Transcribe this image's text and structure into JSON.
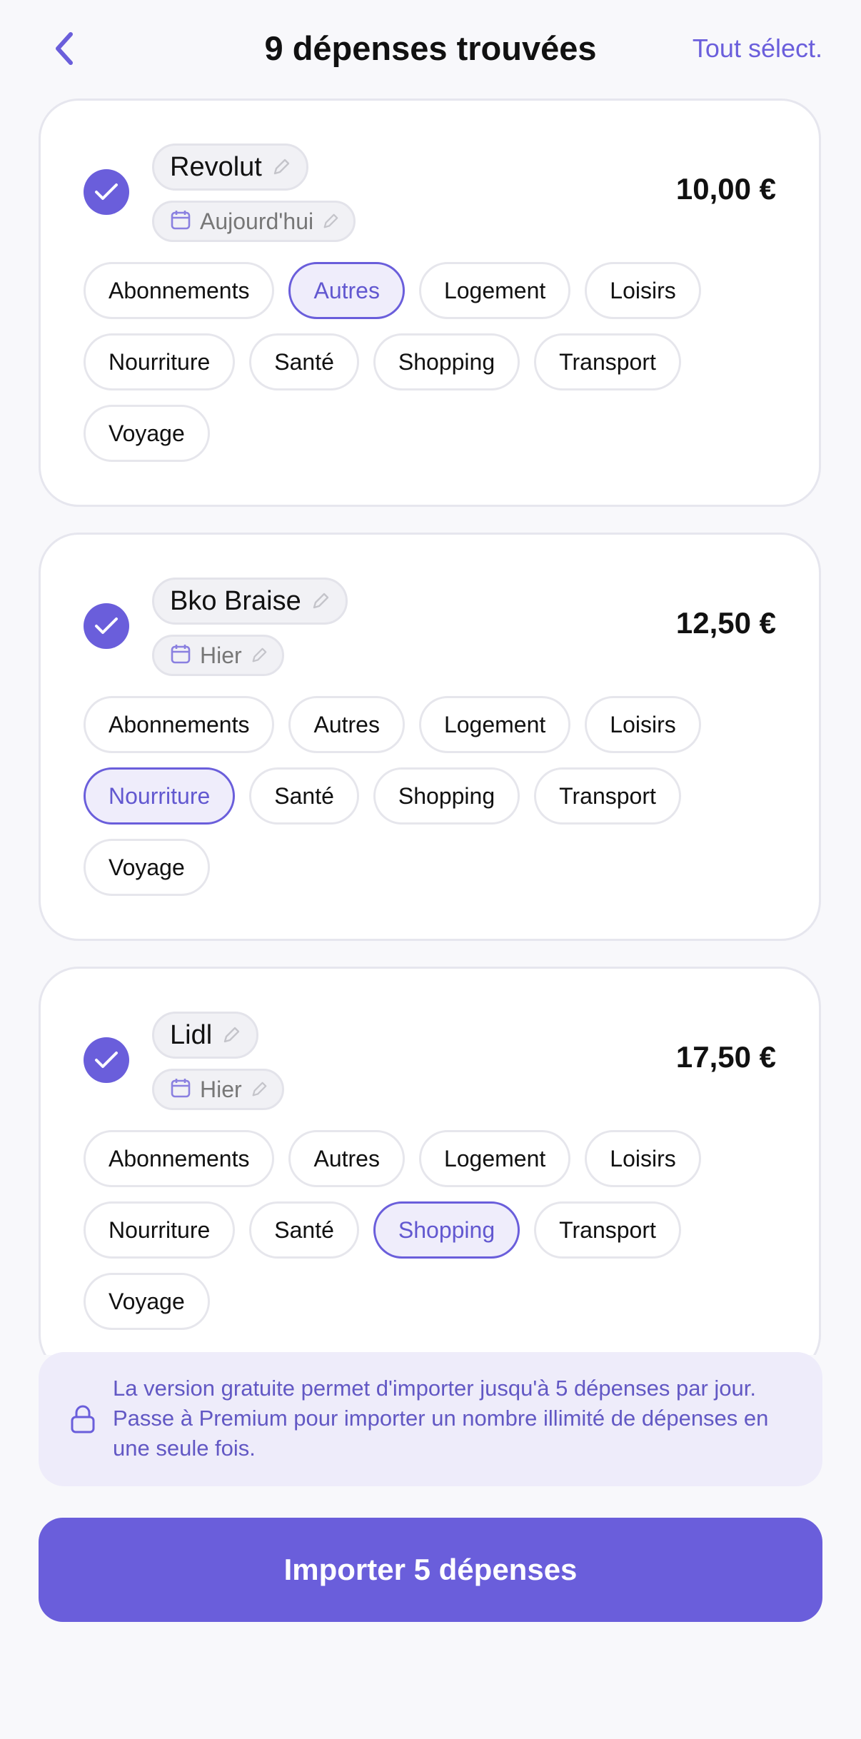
{
  "header": {
    "title": "9 dépenses trouvées",
    "select_all": "Tout sélect."
  },
  "categories": [
    "Abonnements",
    "Autres",
    "Logement",
    "Loisirs",
    "Nourriture",
    "Santé",
    "Shopping",
    "Transport",
    "Voyage"
  ],
  "expenses": [
    {
      "name": "Revolut",
      "date": "Aujourd'hui",
      "amount": "10,00 €",
      "selected_category": "Autres",
      "checked": true
    },
    {
      "name": "Bko Braise",
      "date": "Hier",
      "amount": "12,50 €",
      "selected_category": "Nourriture",
      "checked": true
    },
    {
      "name": "Lidl",
      "date": "Hier",
      "amount": "17,50 €",
      "selected_category": "Shopping",
      "checked": true
    }
  ],
  "banner": {
    "text": "La version gratuite permet d'importer jusqu'à 5 dépenses par jour. Passe à Premium pour importer un nombre illimité de dépenses en une seule fois.",
    "icon": "lock-icon"
  },
  "import_button": {
    "label": "Importer 5 dépenses"
  },
  "colors": {
    "accent": "#6a5edb",
    "background": "#f8f8fb",
    "banner_bg": "#eeecfa"
  }
}
